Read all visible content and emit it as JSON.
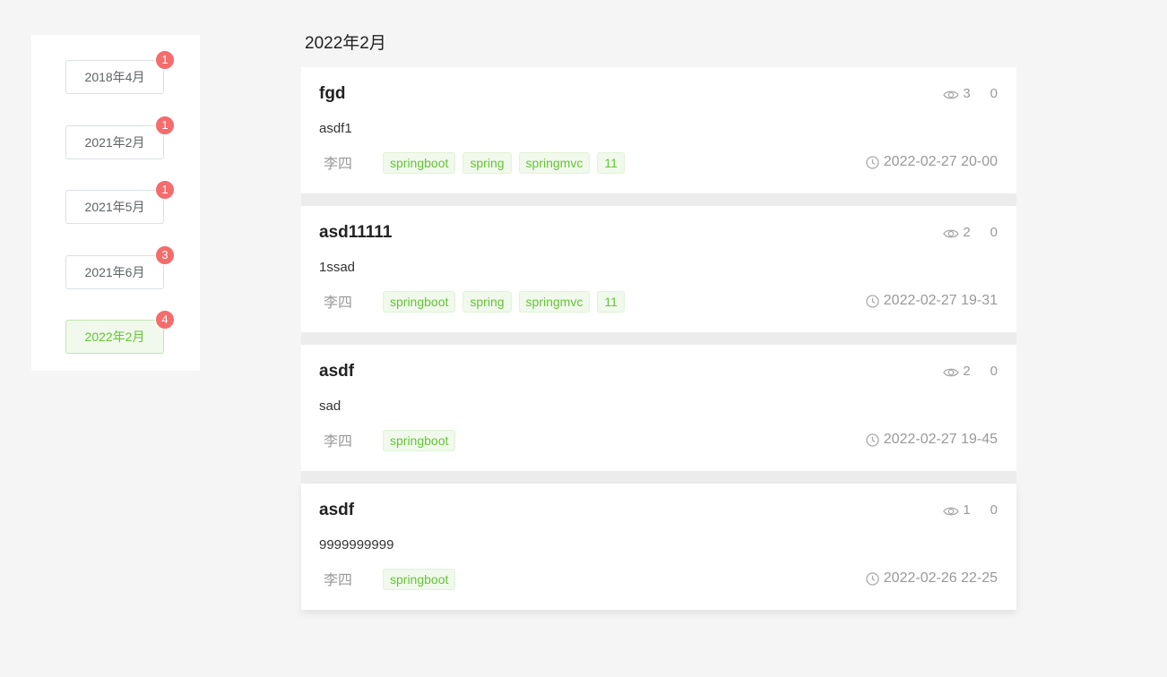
{
  "archives": [
    {
      "label": "2018年4月",
      "count": "1",
      "active": false
    },
    {
      "label": "2021年2月",
      "count": "1",
      "active": false
    },
    {
      "label": "2021年5月",
      "count": "1",
      "active": false
    },
    {
      "label": "2021年6月",
      "count": "3",
      "active": false
    },
    {
      "label": "2022年2月",
      "count": "4",
      "active": true
    }
  ],
  "selected_month": "2022年2月",
  "articles": [
    {
      "title": "fgd",
      "views": "3",
      "comments": "0",
      "summary": "asdf1",
      "author": "李四",
      "tags": [
        "springboot",
        "spring",
        "springmvc",
        "11"
      ],
      "date": "2022-02-27 20-00"
    },
    {
      "title": "asd11111",
      "views": "2",
      "comments": "0",
      "summary": "1ssad",
      "author": "李四",
      "tags": [
        "springboot",
        "spring",
        "springmvc",
        "11"
      ],
      "date": "2022-02-27 19-31"
    },
    {
      "title": "asdf",
      "views": "2",
      "comments": "0",
      "summary": "sad",
      "author": "李四",
      "tags": [
        "springboot"
      ],
      "date": "2022-02-27 19-45"
    },
    {
      "title": "asdf",
      "views": "1",
      "comments": "0",
      "summary": "9999999999",
      "author": "李四",
      "tags": [
        "springboot"
      ],
      "date": "2022-02-26 22-25"
    }
  ],
  "colors": {
    "accent_green": "#67c23a",
    "badge_red": "#f56c6c",
    "muted_text": "#999999"
  },
  "icons": {
    "views": "eye-icon",
    "date": "clock-icon"
  }
}
